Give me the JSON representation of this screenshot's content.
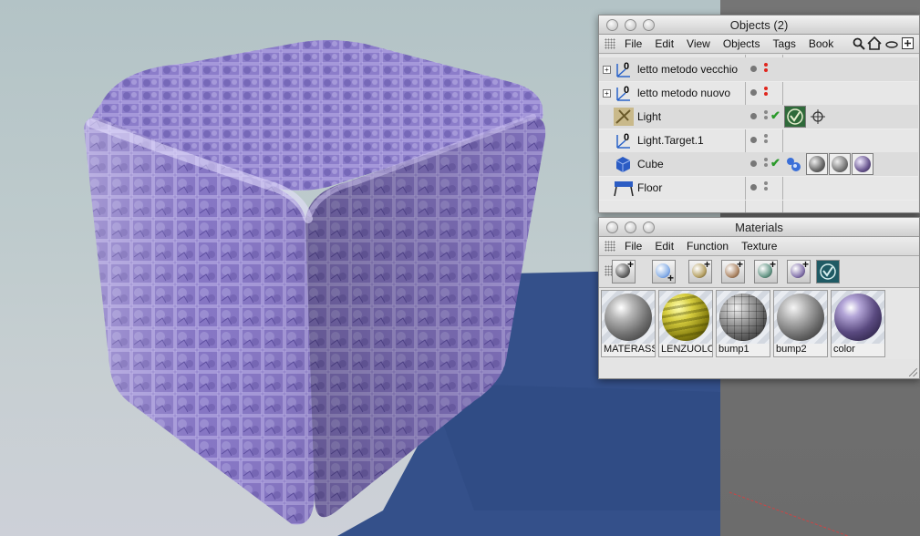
{
  "objects_window": {
    "title": "Objects (2)",
    "menu": [
      "File",
      "Edit",
      "View",
      "Objects",
      "Tags",
      "Book"
    ],
    "toolbar_icons": [
      "search-icon",
      "home-icon",
      "eye-icon",
      "add-panel-icon"
    ],
    "rows": [
      {
        "name": "letto metodo vecchio",
        "icon": "null-object-icon",
        "expandable": true,
        "dots": "red"
      },
      {
        "name": "letto metodo nuovo",
        "icon": "null-object-icon",
        "expandable": true,
        "dots": "red"
      },
      {
        "name": "Light",
        "icon": "light-icon",
        "expandable": false,
        "dots": "gray",
        "checked": true,
        "tags": [
          "target-tag-icon",
          "crosshair-tag-icon"
        ]
      },
      {
        "name": "Light.Target.1",
        "icon": "null-object-icon",
        "expandable": false,
        "dots": "gray"
      },
      {
        "name": "Cube",
        "icon": "cube-icon",
        "expandable": false,
        "dots": "gray",
        "checked": true,
        "tags": [
          "phong-tag-icon",
          "material-tag-icon",
          "material-tag-icon",
          "material-tag-icon"
        ]
      },
      {
        "name": "Floor",
        "icon": "floor-icon",
        "expandable": false,
        "dots": "gray"
      }
    ]
  },
  "materials_window": {
    "title": "Materials",
    "menu": [
      "File",
      "Edit",
      "Function",
      "Texture"
    ],
    "toolbar_icons": [
      "new-material-icon",
      "new-shader-icon",
      "new-material-gold-icon",
      "new-material-copper-icon",
      "new-material-green-icon",
      "new-material-purple-icon",
      "target-icon"
    ],
    "materials": [
      {
        "name": "MATERASS",
        "color": "#9a9a9a"
      },
      {
        "name": "LENZUOLO",
        "color": "#b9b22a"
      },
      {
        "name": "bump1",
        "color": "#8c8c8c"
      },
      {
        "name": "bump2",
        "color": "#999999"
      },
      {
        "name": "color",
        "color": "#7d6a9c"
      }
    ]
  },
  "colors": {
    "cube": "#8a78c6",
    "cube_dark": "#6a5aa8",
    "shadow": "#34508a",
    "background": "#bfcbcd"
  }
}
